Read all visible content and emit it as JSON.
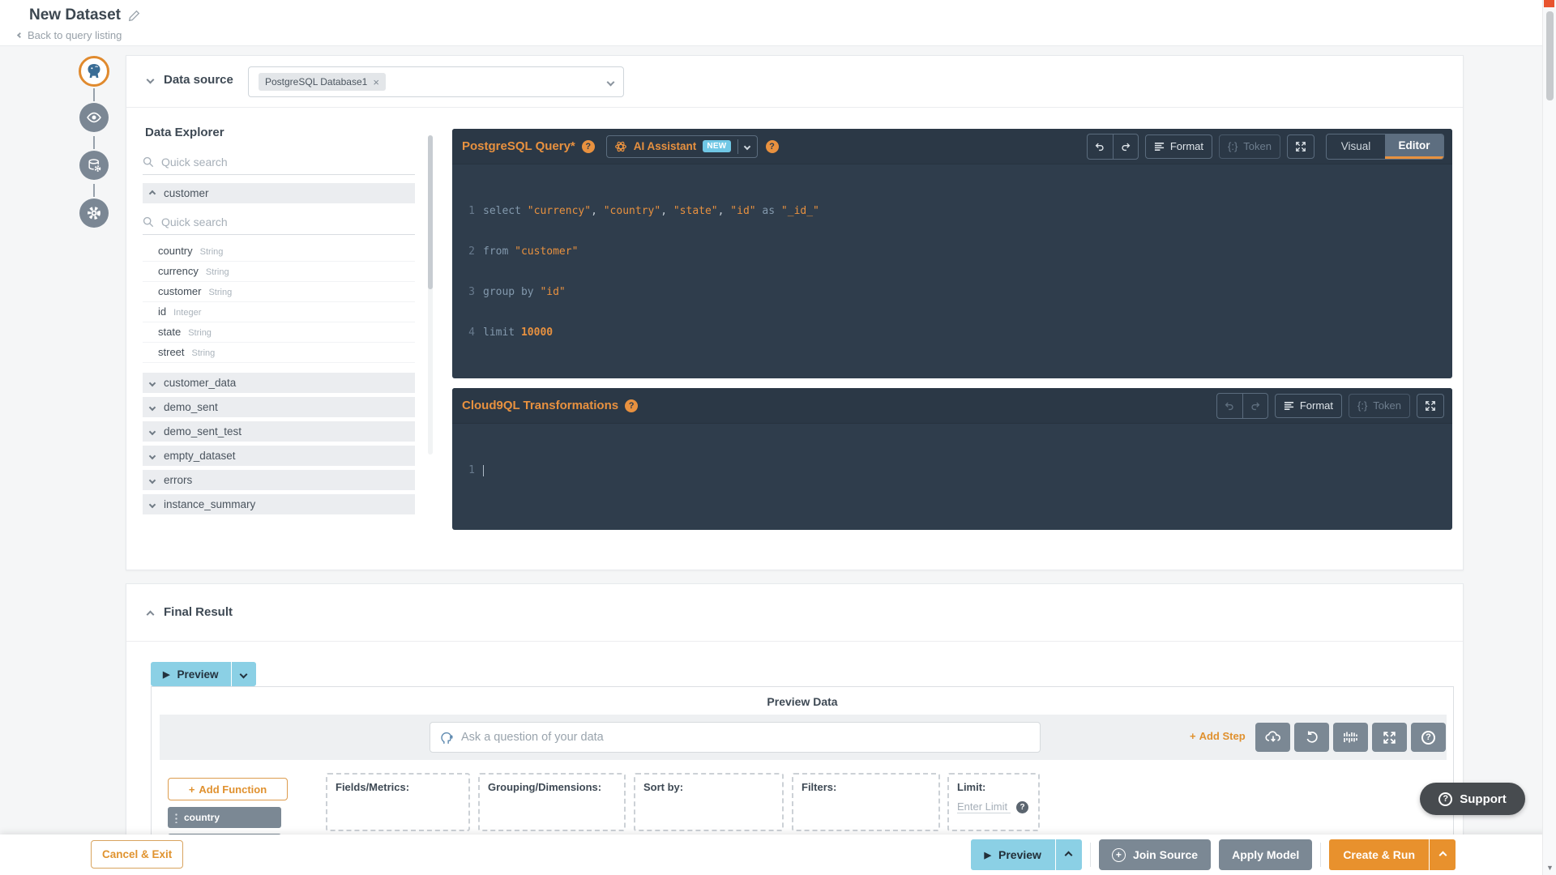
{
  "header": {
    "title": "New Dataset",
    "back": "Back to query listing"
  },
  "glyphs": {
    "question": "?",
    "close": "×",
    "plus": "+",
    "play": "▶",
    "token": "{:}"
  },
  "rail": {
    "icons": [
      "postgresql-icon",
      "eye-icon",
      "database-gear-icon",
      "gear-icon"
    ]
  },
  "data_source": {
    "label": "Data source",
    "tag": "PostgreSQL Database1"
  },
  "explorer": {
    "title": "Data Explorer",
    "search_placeholder": "Quick search",
    "table": {
      "name": "customer",
      "search_placeholder": "Quick search",
      "fields": [
        {
          "name": "country",
          "type": "String"
        },
        {
          "name": "currency",
          "type": "String"
        },
        {
          "name": "customer",
          "type": "String"
        },
        {
          "name": "id",
          "type": "Integer"
        },
        {
          "name": "state",
          "type": "String"
        },
        {
          "name": "street",
          "type": "String"
        }
      ]
    },
    "collapsed": [
      "customer_data",
      "demo_sent",
      "demo_sent_test",
      "empty_dataset",
      "errors",
      "instance_summary"
    ]
  },
  "sql": {
    "title": "PostgreSQL Query*",
    "ai_label": "AI Assistant",
    "ai_badge": "NEW",
    "toolbar": {
      "format": "Format",
      "token": "Token",
      "visual": "Visual",
      "editor": "Editor"
    },
    "code": {
      "l1": {
        "n": "1",
        "k1": "select ",
        "s1": "\"currency\"",
        "c1": ", ",
        "s2": "\"country\"",
        "c2": ", ",
        "s3": "\"state\"",
        "c3": ", ",
        "s4": "\"id\"",
        "k2": " as ",
        "s5": "\"_id_\""
      },
      "l2": {
        "n": "2",
        "k1": "from ",
        "s1": "\"customer\""
      },
      "l3": {
        "n": "3",
        "k1": "group by ",
        "s1": "\"id\""
      },
      "l4": {
        "n": "4",
        "k1": "limit ",
        "num": "10000"
      }
    }
  },
  "c9ql": {
    "title": "Cloud9QL Transformations",
    "line_number": "1",
    "toolbar": {
      "format": "Format",
      "token": "Token"
    }
  },
  "final_result": {
    "title": "Final Result",
    "preview_button": "Preview",
    "panel_title": "Preview Data",
    "ask_placeholder": "Ask a question of your data",
    "add_step": "Add Step",
    "add_function": "Add Function",
    "chip": "country",
    "zones": [
      {
        "label": "Fields/Metrics:"
      },
      {
        "label": "Grouping/Dimensions:"
      },
      {
        "label": "Sort by:"
      },
      {
        "label": "Filters:"
      },
      {
        "label": "Limit:",
        "input_placeholder": "Enter Limit"
      }
    ]
  },
  "footer": {
    "cancel": "Cancel & Exit",
    "preview": "Preview",
    "join": "Join Source",
    "apply": "Apply Model",
    "create": "Create & Run"
  },
  "support": {
    "label": "Support"
  },
  "colors": {
    "accent_orange": "#e8912d",
    "accent_blue": "#8bd0e5",
    "panel_dark": "#2f3d4c",
    "slate_gray": "#7b8894",
    "badge_blue": "#70c7e5"
  }
}
